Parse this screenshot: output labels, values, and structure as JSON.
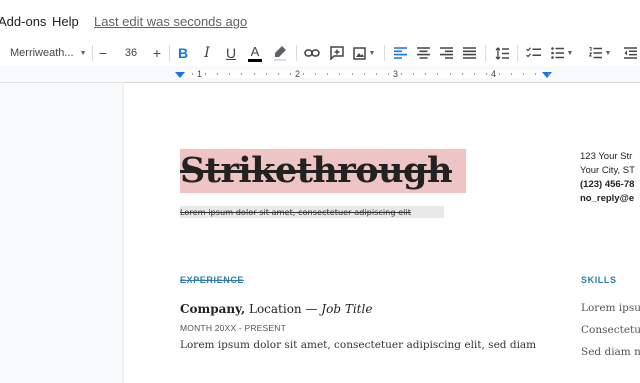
{
  "menu": {
    "addons": "Add-ons",
    "help": "Help",
    "last_edit": "Last edit was seconds ago"
  },
  "toolbar": {
    "font_name": "Merriweath...",
    "font_size": "36",
    "decrease_label": "−",
    "increase_label": "+",
    "bold_label": "B",
    "italic_label": "I",
    "underline_label": "U",
    "text_color_label": "A",
    "text_color_bar": "#000000"
  },
  "ruler": {
    "numbers": [
      "1",
      "2",
      "3",
      "4"
    ]
  },
  "document": {
    "title": "Strikethrough",
    "subtitle": "Lorem ipsum dolor sit amet, consectetuer adipiscing elit",
    "experience_heading": "EXPERIENCE",
    "company": "Company,",
    "location": " Location — ",
    "job_title": "Job Title",
    "dates": "MONTH 20XX - PRESENT",
    "body_line": "Lorem ipsum dolor sit amet, consectetuer adipiscing elit, sed diam",
    "contact": {
      "street": "123 Your Str",
      "city": "Your City, ST",
      "phone": "(123) 456-78",
      "email": "no_reply@e"
    },
    "skills_heading": "SKILLS",
    "skills": [
      "Lorem ipsum",
      "Consectetue",
      "Sed diam n"
    ]
  },
  "colors": {
    "accent": "#1a73e8",
    "title_highlight": "#efc4c4",
    "section_heading": "#2e7dae"
  }
}
